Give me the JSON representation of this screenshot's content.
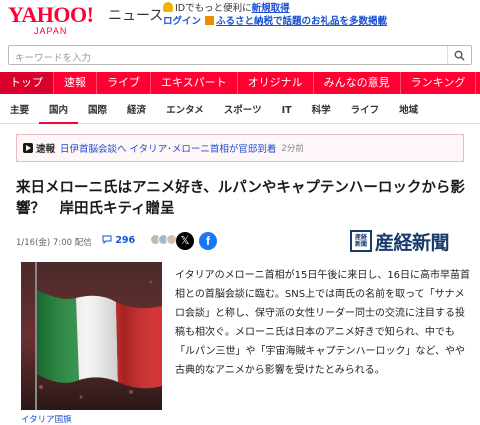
{
  "header": {
    "logo_text": "YAHOO!",
    "logo_sub": "JAPAN",
    "service_name": "ニュース",
    "promo_line1_prefix": "IDでもっと便利に",
    "promo_line1_link": "新規取得",
    "promo_line2_login": "ログイン",
    "promo_line2_link": "ふるさと納税で話題のお礼品を多数掲載"
  },
  "search": {
    "placeholder": "キーワードを入力"
  },
  "primary_nav": [
    "トップ",
    "速報",
    "ライブ",
    "エキスパート",
    "オリジナル",
    "みんなの意見",
    "ランキング"
  ],
  "secondary_nav": [
    "主要",
    "国内",
    "国際",
    "経済",
    "エンタメ",
    "スポーツ",
    "IT",
    "科学",
    "ライフ",
    "地域"
  ],
  "breaking": {
    "label": "速報",
    "text": "日伊首脳会談へ イタリア･メローニ首相が官邸到着",
    "time": "2分前"
  },
  "article": {
    "title": "来日メローニ氏はアニメ好き、ルパンやキャプテンハーロックから影響？　岸田氏キティ贈呈",
    "date": "1/16(金) 7:00 配信",
    "comment_count": "296",
    "publisher": "産経新聞",
    "publisher_seal": "産経\n新聞",
    "caption": "イタリア国旗",
    "body": "イタリアのメローニ首相が15日午後に来日し、16日に高市早苗首相との首脳会談に臨む。SNS上では両氏の名前を取って「サナメロ会談」と称し、保守派の女性リーダー同士の交流に注目する投稿も相次ぐ。メローニ氏は日本のアニメ好きで知られ、中でも「ルパン三世」や「宇宙海賊キャプテンハーロック」など、やや古典的なアニメから影響を受けたとみられる。"
  },
  "colors": {
    "brand": "#ff0033",
    "link": "#1a4fd0",
    "publisher": "#1a3a6b"
  },
  "icons": [
    "search-icon",
    "bell-icon",
    "play-icon",
    "comment-icon",
    "x-icon",
    "facebook-icon"
  ]
}
